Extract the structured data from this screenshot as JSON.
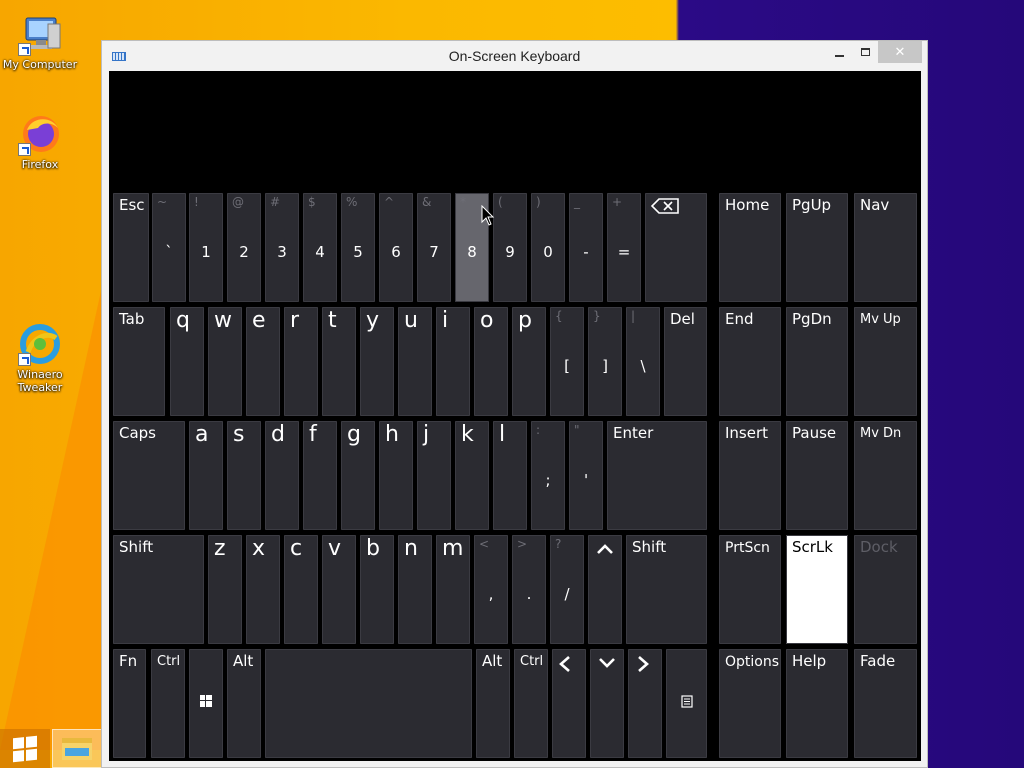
{
  "desktop": {
    "icons": [
      {
        "label": "My Computer"
      },
      {
        "label": "Firefox"
      },
      {
        "label": "Winaero Tweaker"
      }
    ]
  },
  "window": {
    "title": "On-Screen Keyboard",
    "minimize_label": "",
    "maximize_label": "",
    "close_label": "✕"
  },
  "keys": {
    "esc": "Esc",
    "backspace_icon": "backspace-icon",
    "row1": [
      {
        "top": "~",
        "bottom": "`"
      },
      {
        "top": "!",
        "bottom": "1"
      },
      {
        "top": "@",
        "bottom": "2"
      },
      {
        "top": "#",
        "bottom": "3"
      },
      {
        "top": "$",
        "bottom": "4"
      },
      {
        "top": "%",
        "bottom": "5"
      },
      {
        "top": "^",
        "bottom": "6"
      },
      {
        "top": "&",
        "bottom": "7"
      },
      {
        "top": "*",
        "bottom": "8"
      },
      {
        "top": "(",
        "bottom": "9"
      },
      {
        "top": ")",
        "bottom": "0"
      },
      {
        "top": "_",
        "bottom": "-"
      },
      {
        "top": "+",
        "bottom": "="
      }
    ],
    "tab": "Tab",
    "row2": [
      "q",
      "w",
      "e",
      "r",
      "t",
      "y",
      "u",
      "i",
      "o",
      "p"
    ],
    "row2_sym": [
      {
        "top": "{",
        "bottom": "["
      },
      {
        "top": "}",
        "bottom": "]"
      },
      {
        "top": "|",
        "bottom": "\\"
      }
    ],
    "del": "Del",
    "caps": "Caps",
    "row3": [
      "a",
      "s",
      "d",
      "f",
      "g",
      "h",
      "j",
      "k",
      "l"
    ],
    "row3_sym": [
      {
        "top": ":",
        "bottom": ";"
      },
      {
        "top": "\"",
        "bottom": "'"
      }
    ],
    "enter": "Enter",
    "shift_left": "Shift",
    "row4": [
      "z",
      "x",
      "c",
      "v",
      "b",
      "n",
      "m"
    ],
    "row4_sym": [
      {
        "top": "<",
        "bottom": ","
      },
      {
        "top": ">",
        "bottom": "."
      },
      {
        "top": "?",
        "bottom": "/"
      }
    ],
    "up_arrow": "^",
    "shift_right": "Shift",
    "fn": "Fn",
    "ctrl_left": "Ctrl",
    "alt_left": "Alt",
    "alt_right": "Alt",
    "ctrl_right": "Ctrl",
    "left_arrow": "<",
    "down_arrow": "v",
    "right_arrow": ">",
    "nav": {
      "home": "Home",
      "pgup": "PgUp",
      "navkey": "Nav",
      "end": "End",
      "pgdn": "PgDn",
      "mvup": "Mv Up",
      "insert": "Insert",
      "pause": "Pause",
      "mvdn": "Mv Dn",
      "prtscn": "PrtScn",
      "scrlk": "ScrLk",
      "dock": "Dock",
      "options": "Options",
      "help": "Help",
      "fade": "Fade"
    }
  },
  "state": {
    "hovered_key": "8",
    "active_key": "ScrLk",
    "disabled_key": "Dock"
  }
}
